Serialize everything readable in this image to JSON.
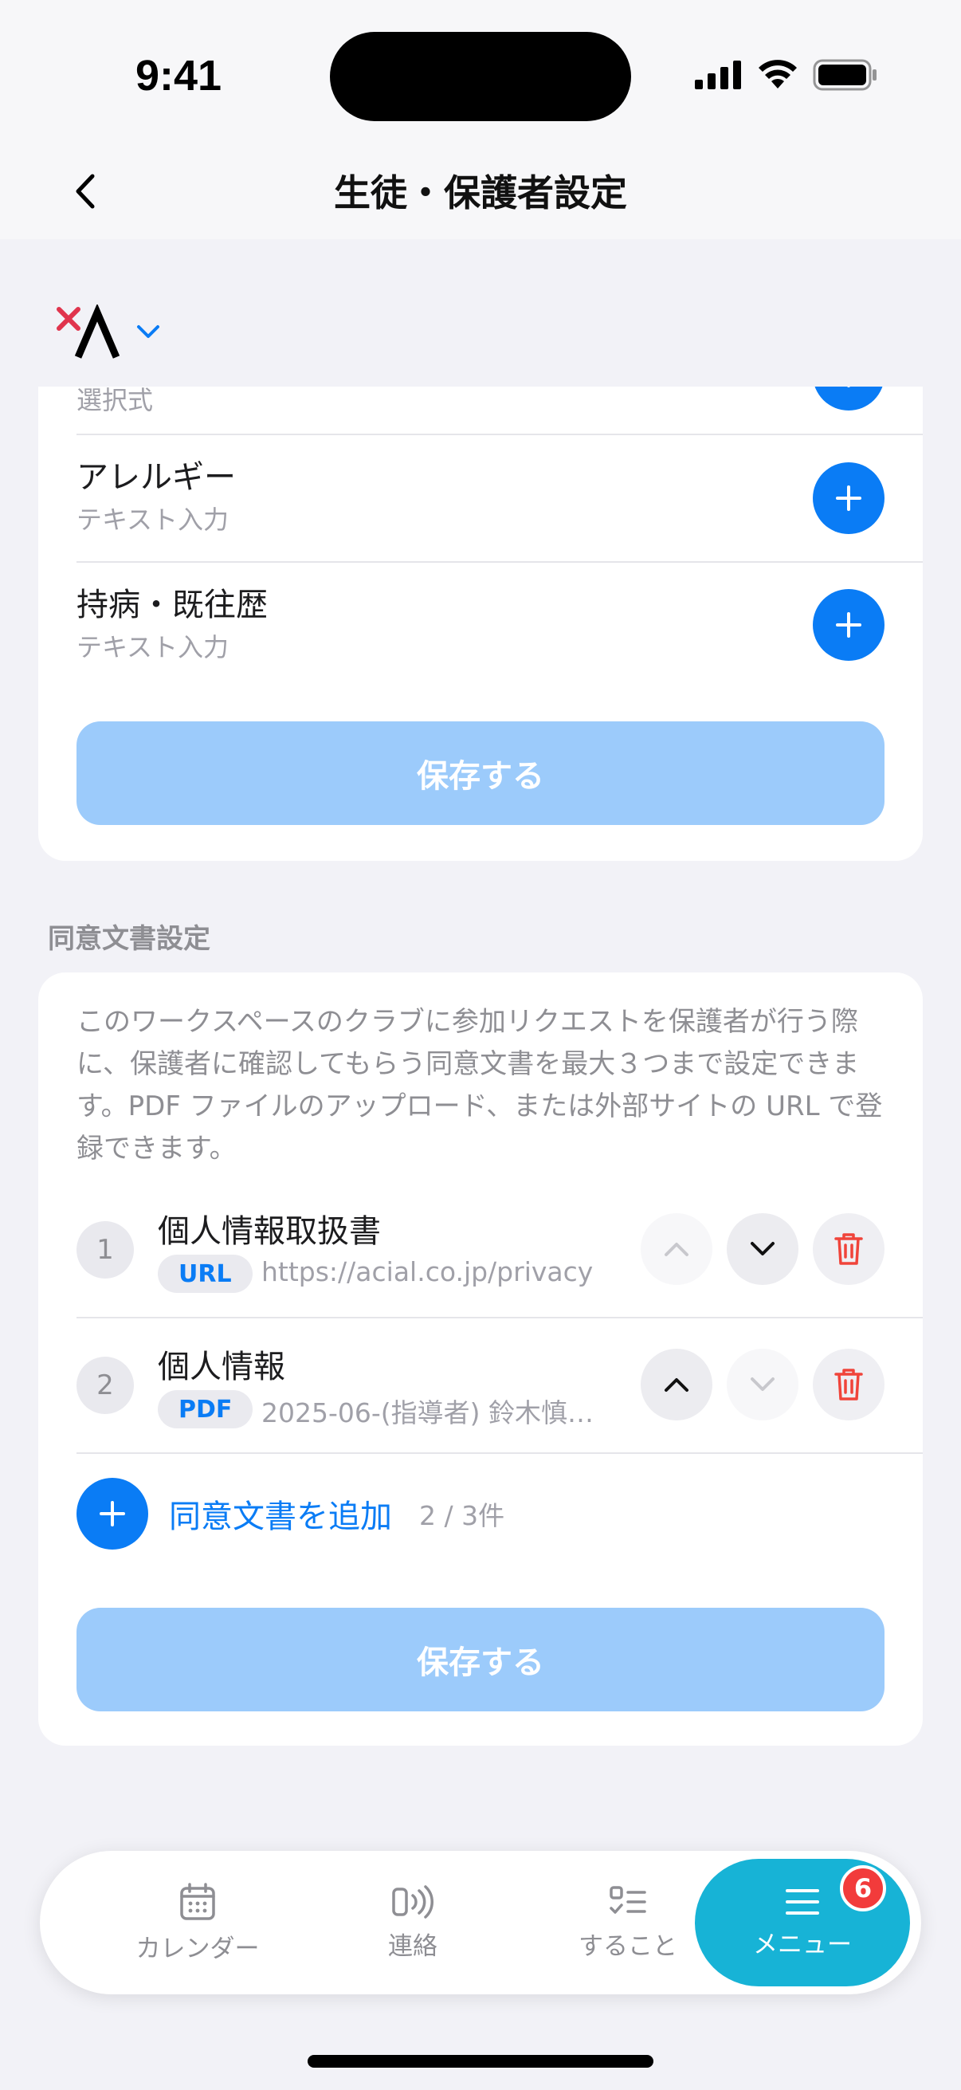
{
  "status_bar": {
    "time": "9:41"
  },
  "header": {
    "title": "生徒・保護者設定"
  },
  "card1": {
    "partial_sub": "選択式",
    "fields": [
      {
        "title": "アレルギー",
        "type": "テキスト入力"
      },
      {
        "title": "持病・既往歴",
        "type": "テキスト入力"
      }
    ],
    "save_label": "保存する"
  },
  "consent": {
    "section_title": "同意文書設定",
    "description": "このワークスペースのクラブに参加リクエストを保護者が行う際に、保護者に確認してもらう同意文書を最大３つまで設定できます。PDF ファイルのアップロード、または外部サイトの URL で登録できます。",
    "documents": [
      {
        "index": "1",
        "title": "個人情報取扱書",
        "type": "URL",
        "source": "https://acial.co.jp/privacy"
      },
      {
        "index": "2",
        "title": "個人情報",
        "type": "PDF",
        "source": "2025-06-(指導者) 鈴木慎吾..."
      }
    ],
    "add_label": "同意文書を追加",
    "count": "2 / 3件",
    "save_label": "保存する"
  },
  "tab_bar": {
    "tabs": [
      {
        "label": "カレンダー",
        "icon": "calendar-icon"
      },
      {
        "label": "連絡",
        "icon": "broadcast-icon"
      },
      {
        "label": "すること",
        "icon": "checklist-icon"
      },
      {
        "label": "メニュー",
        "icon": "menu-icon",
        "active": true,
        "badge": "6"
      }
    ]
  },
  "colors": {
    "accent": "#0a7cf5",
    "save_disabled": "#9ccbfb",
    "tab_active": "#17b3d6",
    "delete": "#f0443a",
    "badge": "#f23b3b"
  }
}
